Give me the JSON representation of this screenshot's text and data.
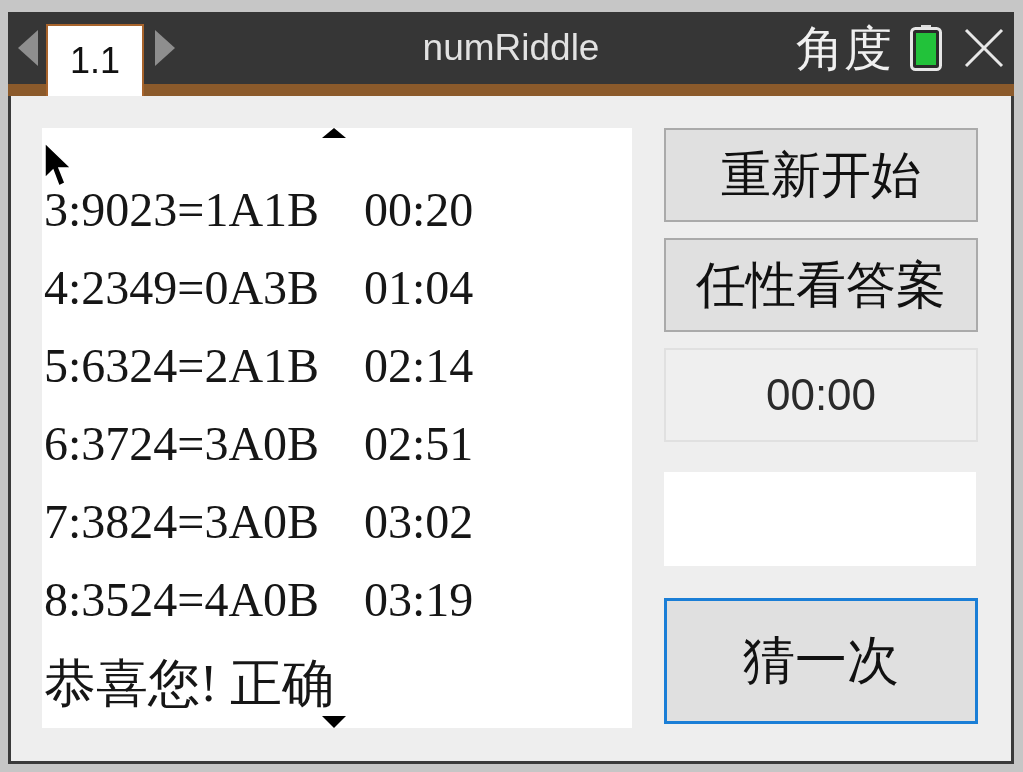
{
  "title_bar": {
    "tabs": [
      {
        "label": "1.1",
        "selected": true
      }
    ],
    "title": "numRiddle",
    "angle_mode": "角度"
  },
  "history": {
    "rows": [
      {
        "guess": "3:9023=1A1B",
        "time": "00:20"
      },
      {
        "guess": "4:2349=0A3B",
        "time": "01:04"
      },
      {
        "guess": "5:6324=2A1B",
        "time": "02:14"
      },
      {
        "guess": "6:3724=3A0B",
        "time": "02:51"
      },
      {
        "guess": "7:3824=3A0B",
        "time": "03:02"
      },
      {
        "guess": "8:3524=4A0B",
        "time": "03:19"
      }
    ],
    "message": "恭喜您! 正确"
  },
  "buttons": [
    {
      "label": "重新开始"
    },
    {
      "label": "任性看答案"
    }
  ],
  "timer": "00:00",
  "guess_button": {
    "label": "猜一次",
    "focused": true
  }
}
